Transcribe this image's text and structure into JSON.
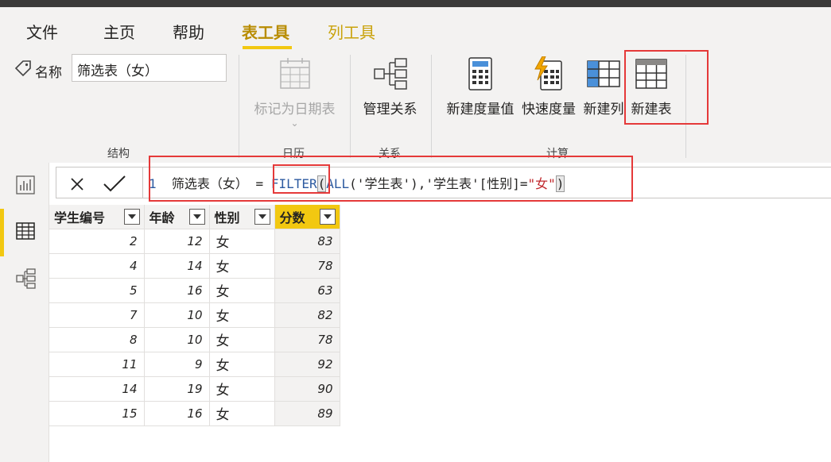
{
  "menu": {
    "tabs": [
      "文件",
      "主页",
      "帮助",
      "表工具",
      "列工具"
    ],
    "active_tab": "表工具"
  },
  "ribbon": {
    "name_label": "名称",
    "name_value": "筛选表（女）",
    "mark_as_date_table": "标记为日期表",
    "manage_relationships": "管理关系",
    "new_measure": "新建度量值",
    "quick_measure": "快速度量",
    "new_column": "新建列",
    "new_table": "新建表",
    "groups": {
      "structure": "结构",
      "calendar": "日历",
      "relationships": "关系",
      "calculations": "计算"
    }
  },
  "formula": {
    "line_number": "1",
    "name": "筛选表（女）",
    "eq": " = ",
    "fn": "FILTER",
    "paren_open": "(",
    "all_fn": "ALL",
    "args": "('学生表'),'学生表'[性别]=",
    "literal": "\"女\"",
    "paren_close": ")"
  },
  "table": {
    "columns": [
      "学生编号",
      "年龄",
      "性别",
      "分数"
    ],
    "selected_column": "分数",
    "rows": [
      [
        "2",
        "12",
        "女",
        "83"
      ],
      [
        "4",
        "14",
        "女",
        "78"
      ],
      [
        "5",
        "16",
        "女",
        "63"
      ],
      [
        "7",
        "10",
        "女",
        "82"
      ],
      [
        "8",
        "10",
        "女",
        "78"
      ],
      [
        "11",
        "9",
        "女",
        "92"
      ],
      [
        "14",
        "19",
        "女",
        "90"
      ],
      [
        "15",
        "16",
        "女",
        "89"
      ]
    ]
  },
  "colors": {
    "accent": "#f2c811",
    "highlight_red": "#e53939",
    "function_blue": "#2c5aa0",
    "string_red": "#c0282d"
  }
}
